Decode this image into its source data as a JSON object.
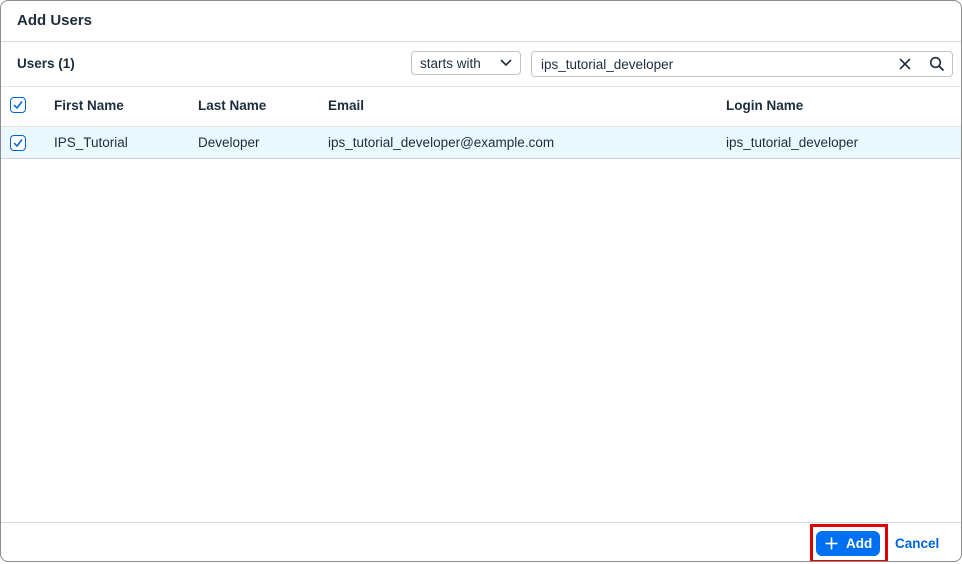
{
  "dialog": {
    "title": "Add Users"
  },
  "toolbar": {
    "users_count_label": "Users (1)",
    "filter_select": {
      "value": "starts with"
    },
    "search": {
      "value": "ips_tutorial_developer"
    }
  },
  "table": {
    "columns": [
      "First Name",
      "Last Name",
      "Email",
      "Login Name"
    ],
    "rows": [
      {
        "selected": true,
        "first_name": "IPS_Tutorial",
        "last_name": "Developer",
        "email": "ips_tutorial_developer@example.com",
        "login_name": "ips_tutorial_developer"
      }
    ],
    "select_all_checked": true
  },
  "footer": {
    "add_label": "Add",
    "cancel_label": "Cancel"
  },
  "colors": {
    "accent": "#0070f2",
    "link": "#0064d9",
    "selected_row": "#ebf8ff",
    "highlight_box": "#e00000"
  },
  "icons": {
    "select_chevron": "chevron-down-icon",
    "clear": "close-icon",
    "search": "search-icon",
    "check": "check-icon",
    "add": "plus-icon"
  }
}
